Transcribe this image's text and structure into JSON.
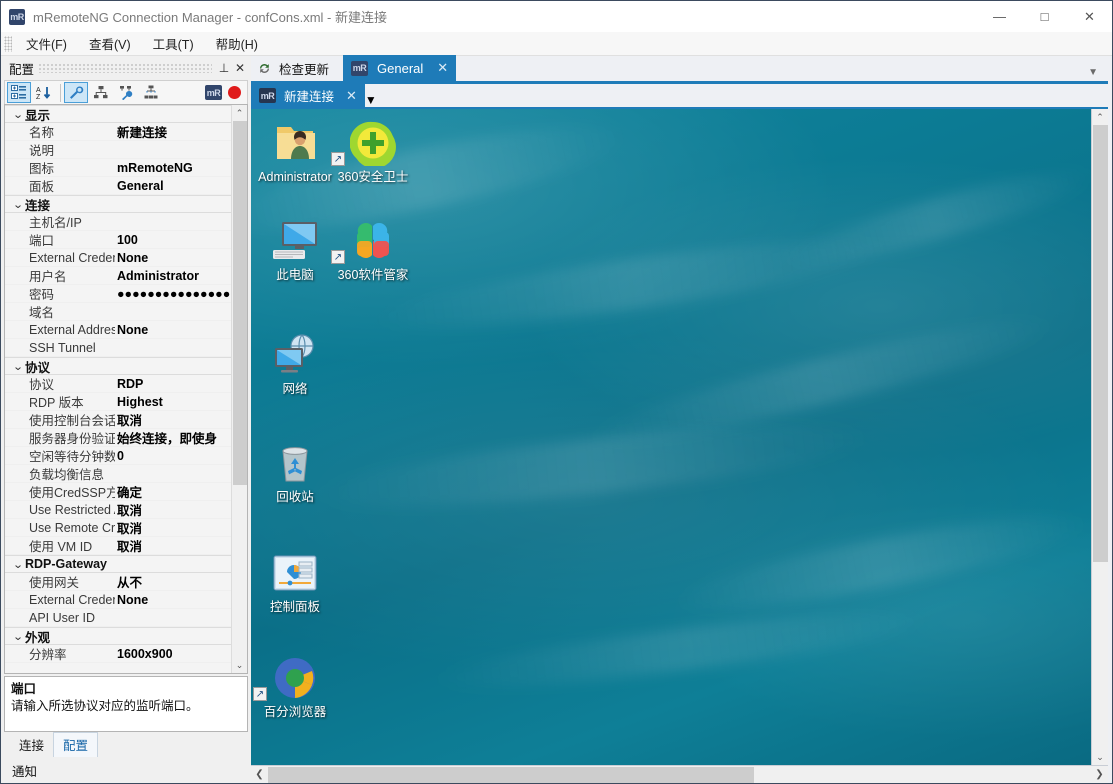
{
  "window": {
    "title": "mRemoteNG Connection Manager - confCons.xml - 新建连接",
    "app_icon": "mR",
    "minimize": "—",
    "maximize": "□",
    "close": "✕"
  },
  "menu": [
    {
      "label": "文件(F)"
    },
    {
      "label": "查看(V)"
    },
    {
      "label": "工具(T)"
    },
    {
      "label": "帮助(H)"
    }
  ],
  "config_panel": {
    "title": "配置",
    "pin_icon": "⊥",
    "close_icon": "✕",
    "toolbar": [
      {
        "name": "categorized-view",
        "glyph": "▤"
      },
      {
        "name": "alphabetical-sort",
        "glyph": "A↓"
      },
      {
        "name": "properties-wrench",
        "glyph": "🔧"
      },
      {
        "name": "inheritance",
        "glyph": "⩎"
      },
      {
        "name": "default-properties",
        "glyph": "⚒"
      },
      {
        "name": "default-inheritance",
        "glyph": "⩏"
      }
    ],
    "badge": "mR",
    "groups": [
      {
        "name": "显示",
        "rows": [
          {
            "label": "名称",
            "value": "新建连接"
          },
          {
            "label": "说明",
            "value": ""
          },
          {
            "label": "图标",
            "value": "mRemoteNG"
          },
          {
            "label": "面板",
            "value": "General"
          }
        ]
      },
      {
        "name": "连接",
        "rows": [
          {
            "label": "主机名/IP",
            "value": ""
          },
          {
            "label": "端口",
            "value": "100"
          },
          {
            "label": "External Credenti",
            "value": "None"
          },
          {
            "label": "用户名",
            "value": "Administrator"
          },
          {
            "label": "密码",
            "value": "●●●●●●●●●●●●●●●"
          },
          {
            "label": "域名",
            "value": ""
          },
          {
            "label": "External Address",
            "value": "None"
          },
          {
            "label": "SSH Tunnel",
            "value": ""
          }
        ]
      },
      {
        "name": "协议",
        "rows": [
          {
            "label": "协议",
            "value": "RDP"
          },
          {
            "label": "RDP 版本",
            "value": "Highest"
          },
          {
            "label": "使用控制台会话",
            "value": "取消"
          },
          {
            "label": "服务器身份验证",
            "value": "始终连接，即使身"
          },
          {
            "label": "空闲等待分钟数",
            "value": "0"
          },
          {
            "label": "负载均衡信息",
            "value": ""
          },
          {
            "label": "使用CredSSP方式",
            "value": "确定"
          },
          {
            "label": "Use Restricted A",
            "value": "取消"
          },
          {
            "label": "Use Remote Cred",
            "value": "取消"
          },
          {
            "label": "使用 VM ID",
            "value": "取消"
          }
        ]
      },
      {
        "name": "RDP-Gateway",
        "rows": [
          {
            "label": "使用网关",
            "value": "从不"
          },
          {
            "label": "External Credenti",
            "value": "None"
          },
          {
            "label": "API User ID",
            "value": ""
          }
        ]
      },
      {
        "name": "外观",
        "rows": [
          {
            "label": "分辨率",
            "value": "1600x900"
          }
        ]
      }
    ],
    "description": {
      "title": "端口",
      "text": "请输入所选协议对应的监听端口。"
    },
    "bottom_tabs": [
      {
        "label": "连接",
        "active": false
      },
      {
        "label": "配置",
        "active": true
      }
    ]
  },
  "status": {
    "notify_label": "通知"
  },
  "main": {
    "quick_action": {
      "label": "检查更新",
      "icon": "refresh-icon"
    },
    "tabs": [
      {
        "label": "General",
        "badge": "mR",
        "close": "✕",
        "active": true
      }
    ],
    "inner_tabs": [
      {
        "label": "新建连接",
        "badge": "mR",
        "close": "✕",
        "active": true
      }
    ],
    "dropdown_icon": "▼"
  },
  "desktop": {
    "icons": [
      {
        "name": "administrator",
        "label": "Administrator",
        "shortcut": false
      },
      {
        "name": "360-safe-guard",
        "label": "360安全卫士",
        "shortcut": true
      },
      {
        "name": "this-pc",
        "label": "此电脑",
        "shortcut": false
      },
      {
        "name": "360-software-manager",
        "label": "360软件管家",
        "shortcut": true
      },
      {
        "name": "network",
        "label": "网络",
        "shortcut": false
      },
      {
        "name": "recycle-bin",
        "label": "回收站",
        "shortcut": false
      },
      {
        "name": "control-panel",
        "label": "控制面板",
        "shortcut": false
      },
      {
        "name": "baifen-browser",
        "label": "百分浏览器",
        "shortcut": true
      }
    ],
    "scroll": {
      "up": "⌃",
      "down": "⌄",
      "left": "❮",
      "right": "❯"
    }
  },
  "colors": {
    "accent": "#1e7bb8",
    "desktop_bg": "#0c7b94",
    "title_icon": "#31456b",
    "record_dot": "#e01b1b"
  }
}
